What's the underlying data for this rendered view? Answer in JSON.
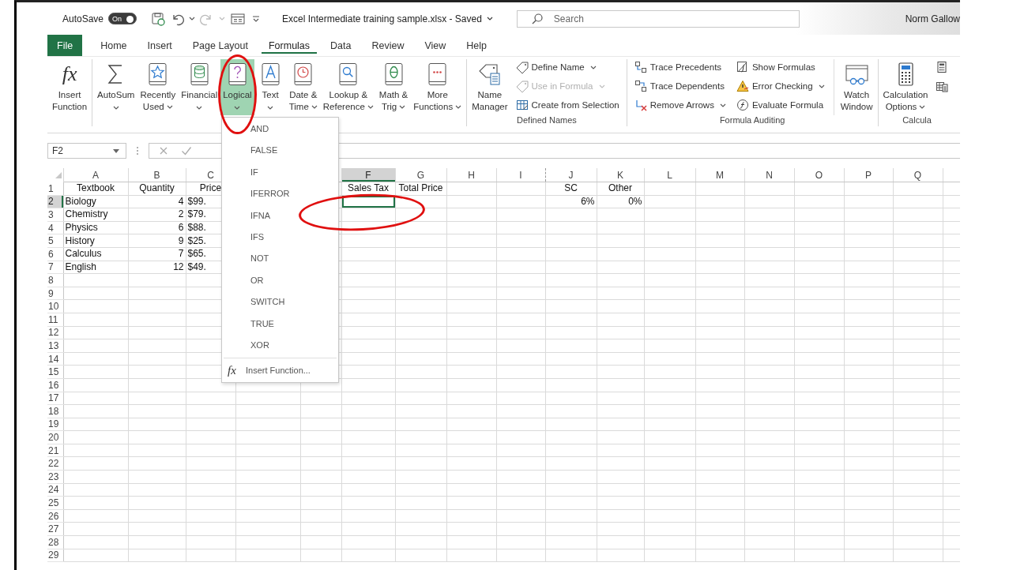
{
  "title_bar": {
    "autosave_label": "AutoSave",
    "autosave": {
      "label": "On",
      "on": true
    },
    "redo_disabled": true,
    "document_title": "Excel Intermediate training sample.xlsx - Saved",
    "search": {
      "placeholder": "Search"
    },
    "user_name": "Norm Gallow"
  },
  "tabs": [
    {
      "label": "File",
      "kind": "backstage",
      "selected": false
    },
    {
      "label": "Home",
      "kind": "tab",
      "selected": false
    },
    {
      "label": "Insert",
      "kind": "tab",
      "selected": false
    },
    {
      "label": "Page Layout",
      "kind": "tab",
      "selected": false
    },
    {
      "label": "Formulas",
      "kind": "tab",
      "selected": true
    },
    {
      "label": "Data",
      "kind": "tab",
      "selected": false
    },
    {
      "label": "Review",
      "kind": "tab",
      "selected": false
    },
    {
      "label": "View",
      "kind": "tab",
      "selected": false
    },
    {
      "label": "Help",
      "kind": "tab",
      "selected": false
    }
  ],
  "ribbon": {
    "groups": [
      {
        "buttons": [
          {
            "kind": "large",
            "icon_text": "fx",
            "lines": [
              "Insert",
              "Function"
            ],
            "has_menu": false,
            "pressed": false
          }
        ]
      },
      {
        "buttons": [
          {
            "kind": "large",
            "lines": [
              "AutoSum"
            ],
            "has_menu": true,
            "pressed": false
          },
          {
            "kind": "large",
            "lines": [
              "Recently",
              "Used"
            ],
            "has_menu": true,
            "pressed": false
          },
          {
            "kind": "large",
            "lines": [
              "Financial"
            ],
            "has_menu": true,
            "pressed": false
          },
          {
            "kind": "large",
            "lines": [
              "Logical"
            ],
            "has_menu": true,
            "pressed": true,
            "circled": true
          },
          {
            "kind": "large",
            "lines": [
              "Text"
            ],
            "has_menu": true,
            "pressed": false
          },
          {
            "kind": "large",
            "lines": [
              "Date &",
              "Time"
            ],
            "has_menu": true,
            "pressed": false
          },
          {
            "kind": "large",
            "lines": [
              "Lookup &",
              "Reference"
            ],
            "has_menu": true,
            "pressed": false
          },
          {
            "kind": "large",
            "lines": [
              "Math &",
              "Trig"
            ],
            "has_menu": true,
            "pressed": false
          },
          {
            "kind": "large",
            "lines": [
              "More",
              "Functions"
            ],
            "has_menu": true,
            "pressed": false
          }
        ]
      },
      {
        "label": "Defined Names",
        "buttons": [
          {
            "kind": "large",
            "lines": [
              "Name",
              "Manager"
            ],
            "has_menu": false,
            "pressed": false
          },
          {
            "kind": "small",
            "lines": [
              "Define Name"
            ],
            "has_menu": true,
            "disabled": false
          },
          {
            "kind": "small",
            "lines": [
              "Use in Formula"
            ],
            "has_menu": true,
            "disabled": true
          },
          {
            "kind": "small",
            "lines": [
              "Create from Selection"
            ],
            "has_menu": false,
            "disabled": false
          }
        ]
      },
      {
        "label": "Formula Auditing",
        "buttons": [
          {
            "kind": "small",
            "lines": [
              "Trace Precedents"
            ],
            "has_menu": false,
            "disabled": false
          },
          {
            "kind": "small",
            "lines": [
              "Trace Dependents"
            ],
            "has_menu": false,
            "disabled": false
          },
          {
            "kind": "small",
            "lines": [
              "Remove Arrows"
            ],
            "has_menu": true,
            "disabled": false
          },
          {
            "kind": "small",
            "lines": [
              "Show Formulas"
            ],
            "has_menu": false,
            "disabled": false
          },
          {
            "kind": "small",
            "lines": [
              "Error Checking"
            ],
            "has_menu": true,
            "disabled": false
          },
          {
            "kind": "small",
            "lines": [
              "Evaluate Formula"
            ],
            "has_menu": false,
            "disabled": false
          },
          {
            "kind": "large",
            "lines": [
              "Watch",
              "Window"
            ],
            "has_menu": false,
            "pressed": false
          }
        ]
      },
      {
        "label": "Calcula",
        "buttons": [
          {
            "kind": "large",
            "lines": [
              "Calculation",
              "Options"
            ],
            "has_menu": true,
            "pressed": false
          },
          {
            "kind": "icon"
          },
          {
            "kind": "icon"
          }
        ]
      }
    ]
  },
  "formula_bar": {
    "name_box": "F2"
  },
  "logical_menu": {
    "items": [
      {
        "label": "AND"
      },
      {
        "label": "FALSE"
      },
      {
        "label": "IF"
      },
      {
        "label": "IFERROR"
      },
      {
        "label": "IFNA"
      },
      {
        "label": "IFS"
      },
      {
        "label": "NOT"
      },
      {
        "label": "OR"
      },
      {
        "label": "SWITCH"
      },
      {
        "label": "TRUE"
      },
      {
        "label": "XOR"
      }
    ],
    "insert_function": {
      "icon_text": "fx",
      "label": "Insert Function..."
    }
  },
  "sheet": {
    "columns": [
      {
        "label": "A",
        "selected": false
      },
      {
        "label": "B",
        "selected": false
      },
      {
        "label": "C",
        "selected": false
      },
      {},
      {},
      {
        "label": "F",
        "selected": true
      },
      {
        "label": "G",
        "selected": false
      },
      {
        "label": "H",
        "selected": false
      },
      {
        "label": "I",
        "selected": false
      },
      {
        "label": "J",
        "selected": false,
        "page_break": true
      },
      {
        "label": "K",
        "selected": false
      },
      {
        "label": "L",
        "selected": false
      },
      {
        "label": "M",
        "selected": false
      },
      {
        "label": "N",
        "selected": false
      },
      {
        "label": "O",
        "selected": false
      },
      {
        "label": "P",
        "selected": false
      },
      {
        "label": "Q",
        "selected": false
      },
      {}
    ],
    "rows": [
      {
        "number": "1",
        "selected": false,
        "cells": [
          {
            "text": "Textbook",
            "kind": "heading"
          },
          {
            "text": "Quantity",
            "kind": "heading"
          },
          {
            "text": "Price",
            "kind": "heading"
          },
          null,
          null,
          {
            "text": "Sales Tax",
            "kind": "heading"
          },
          {
            "text": "Total Price",
            "kind": "heading"
          },
          null,
          null,
          {
            "text": "SC",
            "kind": "heading"
          },
          {
            "text": "Other",
            "kind": "heading"
          }
        ]
      },
      {
        "number": "2",
        "selected": true,
        "cells": [
          {
            "text": "Biology",
            "kind": "text"
          },
          {
            "text": "4",
            "kind": "number"
          },
          {
            "text": "$99.",
            "kind": "text"
          },
          null,
          null,
          {
            "selected": true,
            "circled": true
          },
          null,
          null,
          null,
          {
            "text": "6%",
            "kind": "number"
          },
          {
            "text": "0%",
            "kind": "number"
          }
        ]
      },
      {
        "number": "3",
        "selected": false,
        "cells": [
          {
            "text": "Chemistry",
            "kind": "text"
          },
          {
            "text": "2",
            "kind": "number"
          },
          {
            "text": "$79.",
            "kind": "text"
          }
        ]
      },
      {
        "number": "4",
        "selected": false,
        "cells": [
          {
            "text": "Physics",
            "kind": "text"
          },
          {
            "text": "6",
            "kind": "number"
          },
          {
            "text": "$88.",
            "kind": "text"
          }
        ]
      },
      {
        "number": "5",
        "selected": false,
        "cells": [
          {
            "text": "History",
            "kind": "text"
          },
          {
            "text": "9",
            "kind": "number"
          },
          {
            "text": "$25.",
            "kind": "text"
          }
        ]
      },
      {
        "number": "6",
        "selected": false,
        "cells": [
          {
            "text": "Calculus",
            "kind": "text"
          },
          {
            "text": "7",
            "kind": "number"
          },
          {
            "text": "$65.",
            "kind": "text"
          }
        ]
      },
      {
        "number": "7",
        "selected": false,
        "cells": [
          {
            "text": "English",
            "kind": "text"
          },
          {
            "text": "12",
            "kind": "number"
          },
          {
            "text": "$49.",
            "kind": "text"
          }
        ]
      },
      {
        "number": "8",
        "selected": false
      },
      {
        "number": "9",
        "selected": false
      },
      {
        "number": "10",
        "selected": false
      },
      {
        "number": "11",
        "selected": false
      },
      {
        "number": "12",
        "selected": false
      },
      {
        "number": "13",
        "selected": false
      },
      {
        "number": "14",
        "selected": false
      },
      {
        "number": "15",
        "selected": false
      },
      {
        "number": "16",
        "selected": false
      },
      {
        "number": "17",
        "selected": false
      },
      {
        "number": "18",
        "selected": false
      },
      {
        "number": "19",
        "selected": false
      },
      {
        "number": "20",
        "selected": false
      },
      {
        "number": "21",
        "selected": false
      },
      {
        "number": "22",
        "selected": false
      },
      {
        "number": "23",
        "selected": false
      },
      {
        "number": "24",
        "selected": false
      },
      {
        "number": "25",
        "selected": false
      },
      {
        "number": "26",
        "selected": false
      },
      {
        "number": "27",
        "selected": false
      },
      {
        "number": "28",
        "selected": false
      },
      {
        "number": "29",
        "selected": false
      }
    ]
  }
}
